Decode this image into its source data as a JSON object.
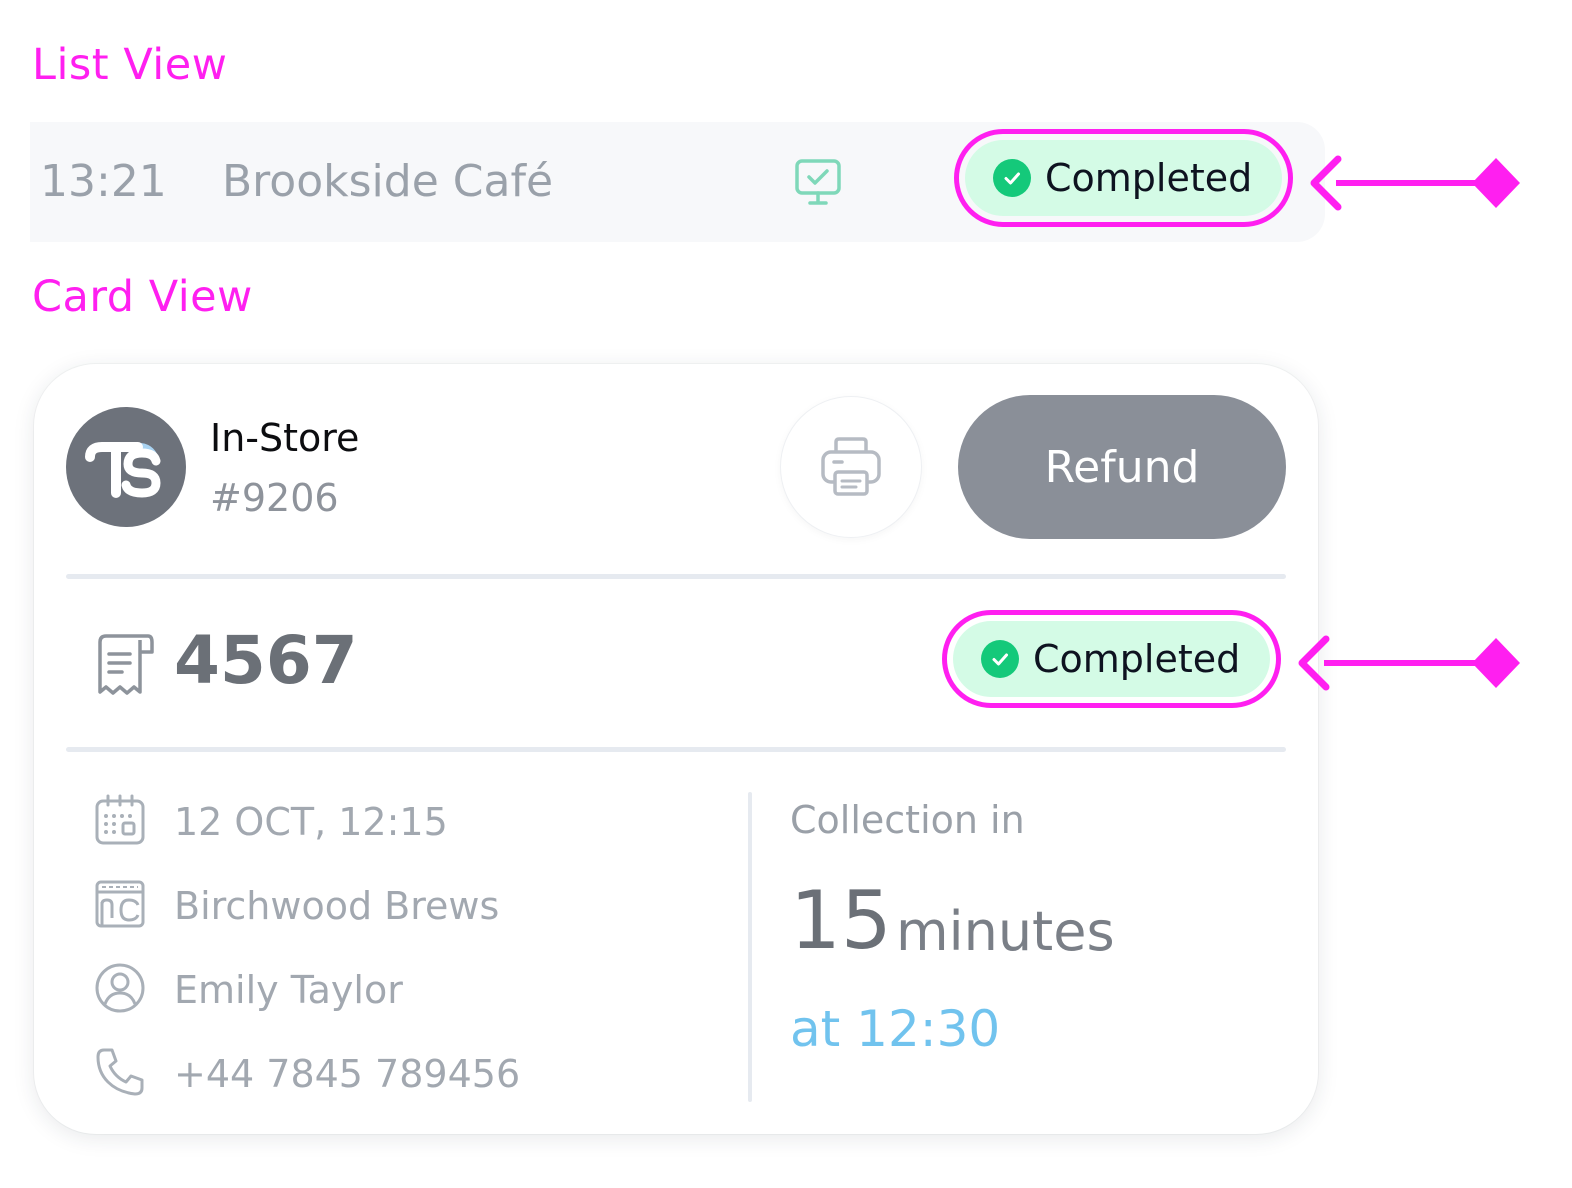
{
  "labels": {
    "list_view": "List View",
    "card_view": "Card View"
  },
  "list_row": {
    "time": "13:21",
    "name": "Brookside Café",
    "channel_icon": "monitor-check-icon",
    "status": "Completed"
  },
  "card": {
    "avatar_logo": "TS",
    "channel": "In-Store",
    "order_number": "#9206",
    "print_icon": "printer-icon",
    "refund_label": "Refund",
    "receipt_number": "4567",
    "status": "Completed",
    "details": {
      "datetime": "12 OCT, 12:15",
      "location": "Birchwood Brews",
      "customer": "Emily Taylor",
      "phone": "+44 7845 789456"
    },
    "collection": {
      "label": "Collection in",
      "value": "15",
      "unit": "minutes",
      "time": "at 12:30"
    }
  },
  "colors": {
    "annotation": "#ff1ff0",
    "status_bg": "#d4fbe6",
    "status_check": "#14c97a",
    "refund_bg": "#8a8f98",
    "accent_time": "#71c3ee"
  }
}
